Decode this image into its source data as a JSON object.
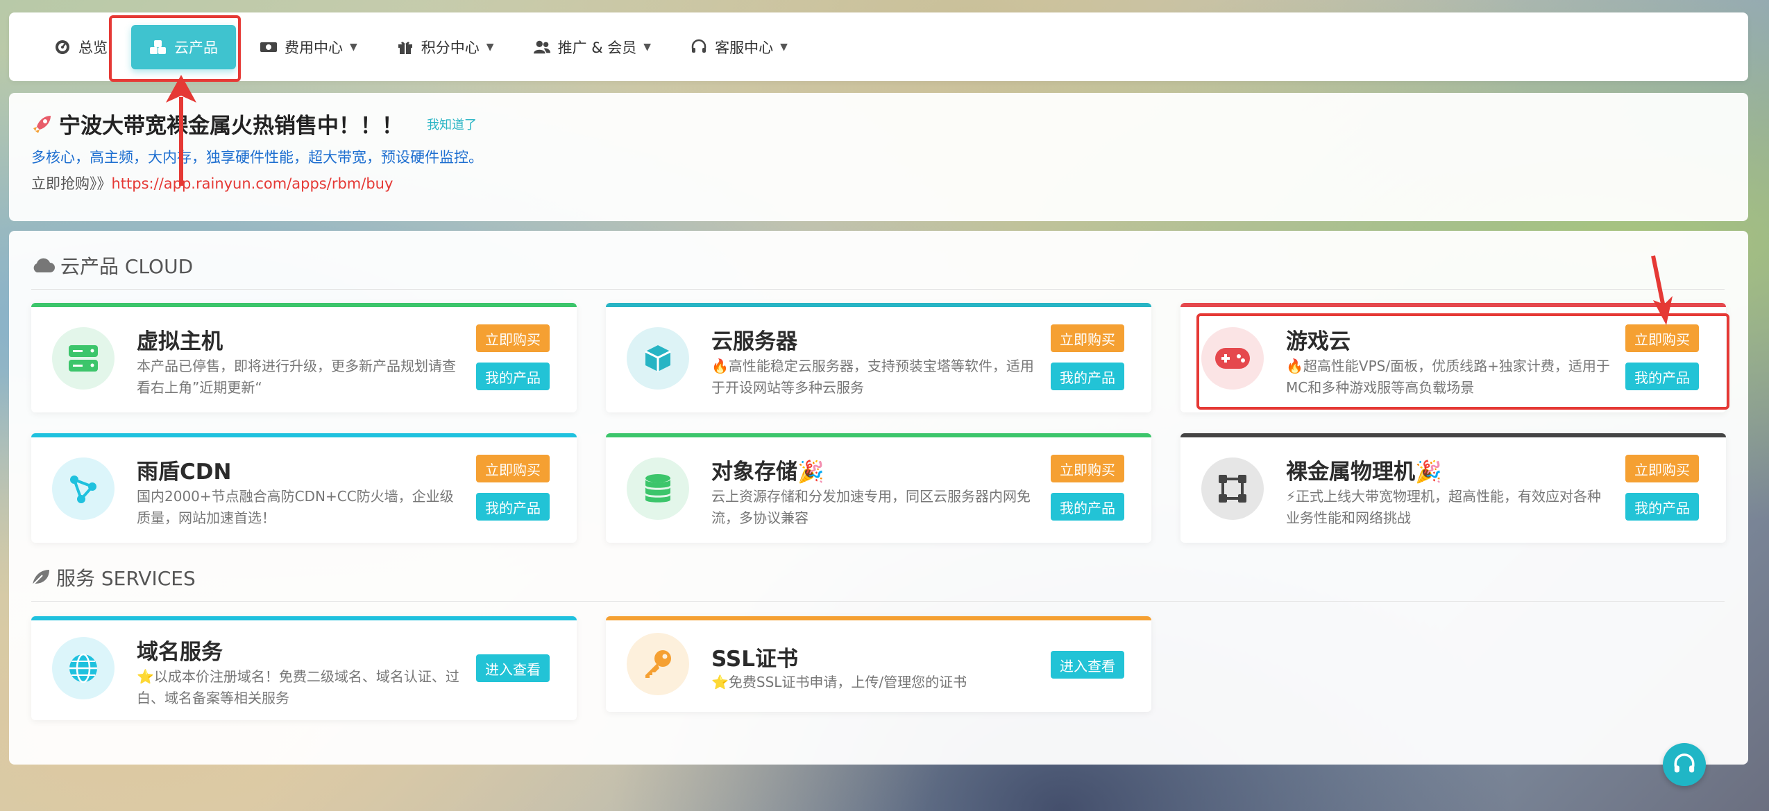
{
  "nav": {
    "items": [
      {
        "label": "总览",
        "icon": "dashboard-icon",
        "dropdown": false,
        "active": false
      },
      {
        "label": "云产品",
        "icon": "cubes-icon",
        "dropdown": false,
        "active": true
      },
      {
        "label": "费用中心",
        "icon": "money-icon",
        "dropdown": true,
        "active": false
      },
      {
        "label": "积分中心",
        "icon": "gift-icon",
        "dropdown": true,
        "active": false
      },
      {
        "label": "推广 & 会员",
        "icon": "users-icon",
        "dropdown": true,
        "active": false
      },
      {
        "label": "客服中心",
        "icon": "headset-icon",
        "dropdown": true,
        "active": false
      }
    ]
  },
  "notice": {
    "title": "宁波大带宽裸金属火热销售中！！！",
    "dismiss": "我知道了",
    "line1": "多核心，高主频，大内存，独享硬件性能，超大带宽，预设硬件监控。",
    "line2_prefix": "立即抢购》》",
    "line2_link": "https://app.rainyun.com/apps/rbm/buy"
  },
  "cloud": {
    "title": "云产品 CLOUD",
    "products": [
      {
        "name": "虚拟主机",
        "desc": "本产品已停售，即将进行升级，更多新产品规划请查看右上角”近期更新“",
        "buy": "立即购买",
        "mine": "我的产品",
        "accent": "#3cc56b"
      },
      {
        "name": "云服务器",
        "desc": "🔥高性能稳定云服务器，支持预装宝塔等软件，适用于开设网站等多种云服务",
        "buy": "立即购买",
        "mine": "我的产品",
        "accent": "#27b4c4"
      },
      {
        "name": "游戏云",
        "desc": "🔥超高性能VPS/面板，优质线路+独家计费，适用于MC和多种游戏服等高负载场景",
        "buy": "立即购买",
        "mine": "我的产品",
        "accent": "#e5484d"
      },
      {
        "name": "雨盾CDN",
        "desc": "国内2000+节点融合高防CDN+CC防火墙，企业级质量，网站加速首选！",
        "buy": "立即购买",
        "mine": "我的产品",
        "accent": "#1fc1de"
      },
      {
        "name": "对象存储🎉",
        "desc": "云上资源存储和分发加速专用，同区云服务器内网免流，多协议兼容",
        "buy": "立即购买",
        "mine": "我的产品",
        "accent": "#3cc56b"
      },
      {
        "name": "裸金属物理机🎉",
        "desc": "⚡正式上线大带宽物理机，超高性能，有效应对各种业务性能和网络挑战",
        "buy": "立即购买",
        "mine": "我的产品",
        "accent": "#444444"
      }
    ]
  },
  "services": {
    "title": "服务 SERVICES",
    "items": [
      {
        "name": "域名服务",
        "desc": "⭐以成本价注册域名！免费二级域名、域名认证、过白、域名备案等相关服务",
        "enter": "进入查看",
        "accent": "#1fc1de"
      },
      {
        "name": "SSL证书",
        "desc": "⭐免费SSL证书申请，上传/管理您的证书",
        "enter": "进入查看",
        "accent": "#f5a032"
      }
    ]
  }
}
